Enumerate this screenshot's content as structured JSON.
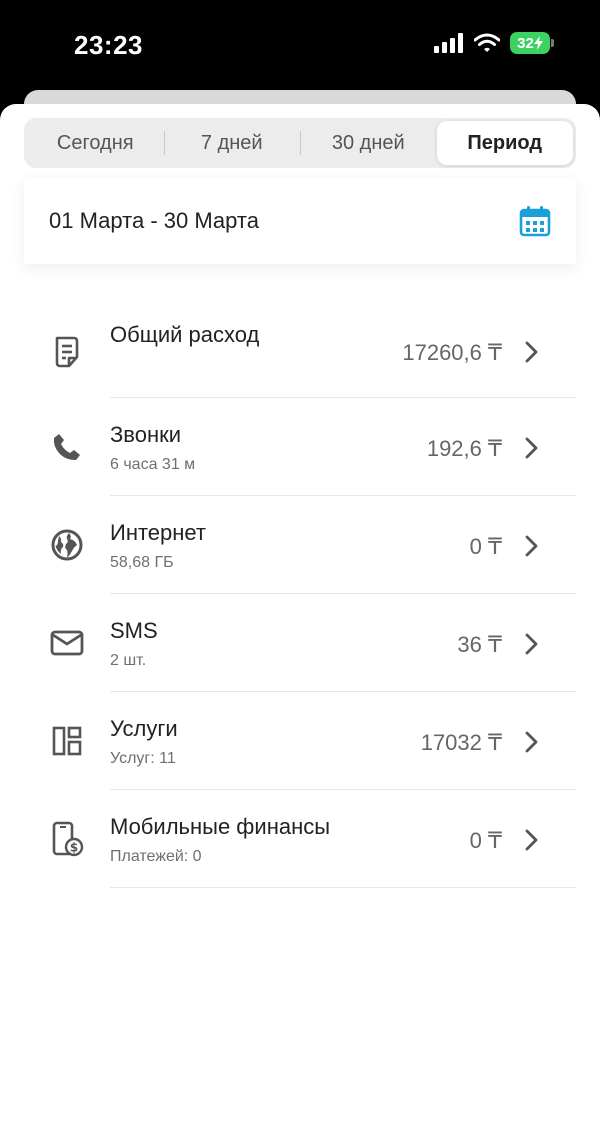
{
  "status": {
    "time": "23:23",
    "battery": "32"
  },
  "tabs": [
    {
      "label": "Сегодня"
    },
    {
      "label": "7 дней"
    },
    {
      "label": "30 дней"
    },
    {
      "label": "Период",
      "active": true
    }
  ],
  "period": {
    "range": "01 Марта - 30 Марта",
    "icon": "calendar-icon"
  },
  "items": [
    {
      "title": "Общий расход",
      "subtitle": "",
      "value": "17260,6 ₸",
      "icon": "receipt-icon"
    },
    {
      "title": "Звонки",
      "subtitle": "6 часа 31 м",
      "value": "192,6 ₸",
      "icon": "phone-icon"
    },
    {
      "title": "Интернет",
      "subtitle": "58,68 ГБ",
      "value": "0 ₸",
      "icon": "globe-icon"
    },
    {
      "title": "SMS",
      "subtitle": "2 шт.",
      "value": "36 ₸",
      "icon": "envelope-icon"
    },
    {
      "title": "Услуги",
      "subtitle": "Услуг: 11",
      "value": "17032 ₸",
      "icon": "services-icon"
    },
    {
      "title": "Мобильные финансы",
      "subtitle": "Платежей: 0",
      "value": "0 ₸",
      "icon": "mobile-finance-icon"
    }
  ],
  "colors": {
    "accent": "#1a9fd9",
    "battery": "#3dd161",
    "icon": "#555555"
  }
}
